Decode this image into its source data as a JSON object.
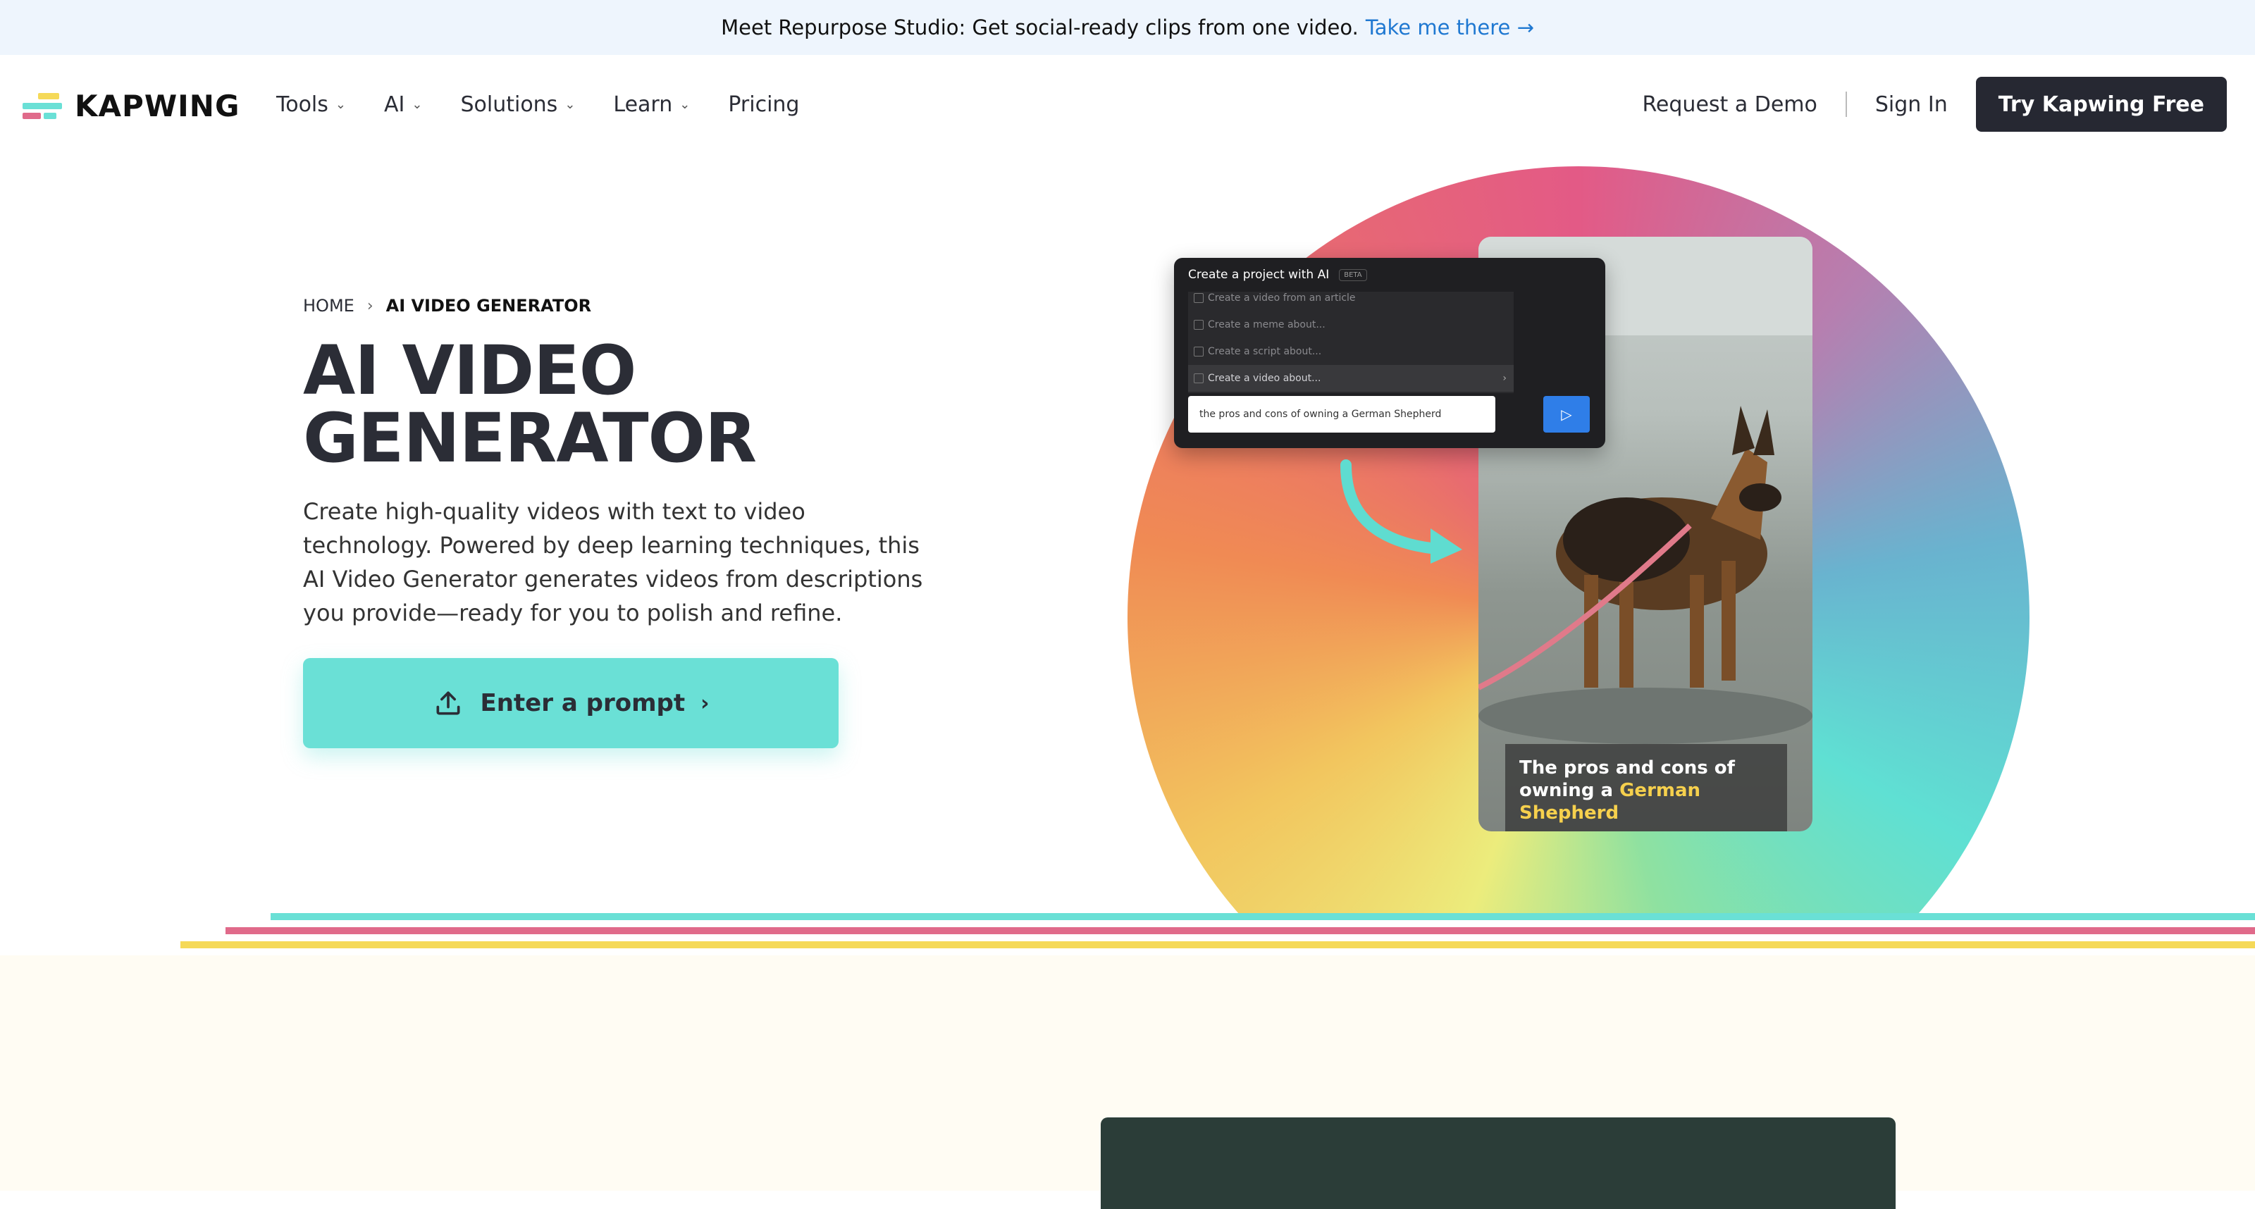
{
  "banner": {
    "text": "Meet Repurpose Studio: Get social-ready clips from one video.",
    "link": "Take me there →"
  },
  "nav": {
    "logo": "KAPWING",
    "links": [
      {
        "label": "Tools",
        "dropdown": true
      },
      {
        "label": "AI",
        "dropdown": true
      },
      {
        "label": "Solutions",
        "dropdown": true
      },
      {
        "label": "Learn",
        "dropdown": true
      },
      {
        "label": "Pricing",
        "dropdown": false
      }
    ],
    "request_demo": "Request a Demo",
    "sign_in": "Sign In",
    "try_free": "Try Kapwing Free"
  },
  "breadcrumb": {
    "home": "HOME",
    "current": "AI VIDEO GENERATOR"
  },
  "hero": {
    "title_line1": "AI VIDEO",
    "title_line2": "GENERATOR",
    "description": "Create high-quality videos with text to video technology. Powered by deep learning techniques, this AI Video Generator generates videos from descriptions you provide—ready for you to polish and refine.",
    "cta": "Enter a prompt"
  },
  "ai_panel": {
    "title": "Create a project with AI",
    "badge": "BETA",
    "options": [
      "Create a video from an article",
      "Create a meme about...",
      "Create a script about...",
      "Create a video about..."
    ],
    "input_value": "the pros and cons of owning a German Shepherd"
  },
  "video_caption": {
    "line1": "The pros and cons of",
    "line2_prefix": "owning a",
    "highlight": "German Shepherd"
  },
  "colors": {
    "accent_teal": "#6ae0d6",
    "accent_pink": "#e06a8a",
    "accent_yellow": "#f5d958",
    "dark_button": "#262832",
    "link_blue": "#1f78d1"
  }
}
